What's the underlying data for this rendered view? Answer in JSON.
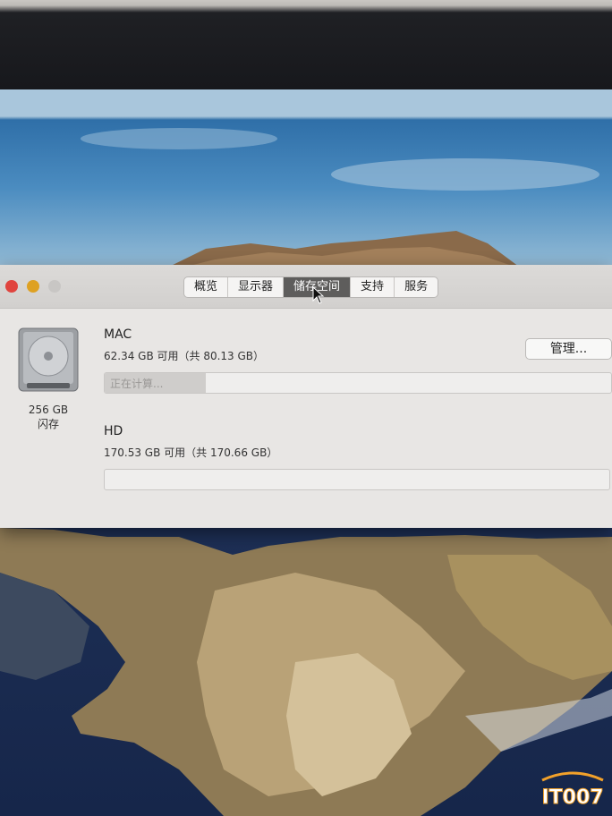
{
  "window": {
    "tabs": [
      {
        "label": "概览"
      },
      {
        "label": "显示器"
      },
      {
        "label": "储存空间"
      },
      {
        "label": "支持"
      },
      {
        "label": "服务"
      }
    ],
    "active_tab": "储存空间"
  },
  "drive": {
    "capacity": "256 GB",
    "type": "闪存"
  },
  "volumes": [
    {
      "name": "MAC",
      "free_text": "62.34 GB 可用（共 80.13 GB）",
      "bar_status": "正在计算...",
      "calculating_fraction": 0.2
    },
    {
      "name": "HD",
      "free_text": "170.53 GB 可用（共 170.66 GB）",
      "bar_status": ""
    }
  ],
  "manage_button": {
    "label": "管理..."
  },
  "watermark": {
    "text": "IT007"
  },
  "colors": {
    "close": "#e0443e",
    "minimize": "#dea123",
    "zoom": "#c8c6c4",
    "active_tab": "#5e5d5c"
  }
}
